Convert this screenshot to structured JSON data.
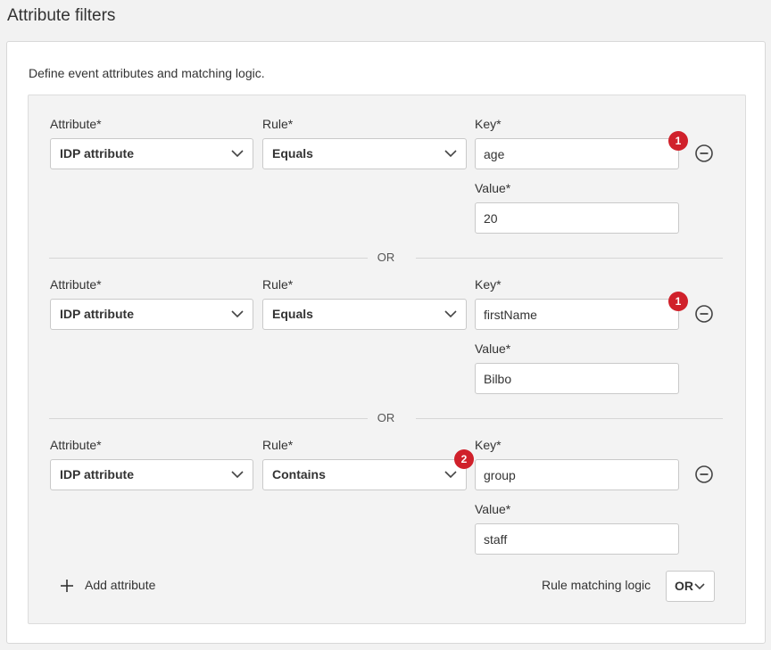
{
  "page": {
    "title": "Attribute filters"
  },
  "card": {
    "description": "Define event attributes and matching logic."
  },
  "labels": {
    "attribute": "Attribute*",
    "rule": "Rule*",
    "key": "Key*",
    "value": "Value*"
  },
  "filters": [
    {
      "attribute": "IDP attribute",
      "rule": "Equals",
      "key": "age",
      "value": "20",
      "badge": "1"
    },
    {
      "attribute": "IDP attribute",
      "rule": "Equals",
      "key": "firstName",
      "value": "Bilbo",
      "badge": "1"
    },
    {
      "attribute": "IDP attribute",
      "rule": "Contains",
      "key": "group",
      "value": "staff",
      "badge": "2"
    }
  ],
  "divider_text": "OR",
  "footer": {
    "add_attribute_label": "Add attribute",
    "rule_matching_logic_label": "Rule matching logic",
    "rule_matching_logic_value": "OR"
  },
  "icons": {
    "add": "plus-icon",
    "remove": "minus-circle-icon",
    "dropdown": "chevron-down-icon"
  },
  "colors": {
    "badge": "#d0212b"
  }
}
